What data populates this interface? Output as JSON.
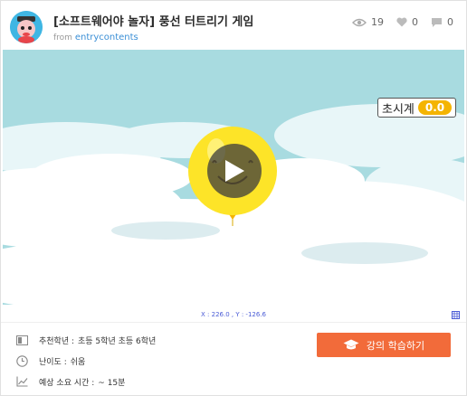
{
  "header": {
    "title": "[소프트웨어야 놀자] 풍선 터트리기 게임",
    "from_label": "from",
    "author": "entrycontents"
  },
  "stats": {
    "views": "19",
    "likes": "0",
    "comments": "0"
  },
  "stage": {
    "timer_label": "초시계",
    "timer_value": "0.0"
  },
  "coords": "X : 226.0 , Y : -126.6",
  "info": {
    "grade_label": "추천학년 :",
    "grade_value": "초등 5학년 초등 6학년",
    "difficulty_label": "난이도 :",
    "difficulty_value": "쉬움",
    "time_label": "예상 소요 시간 :",
    "time_value": "~ 15분"
  },
  "study_button": "강의 학습하기",
  "colors": {
    "accent": "#f26b3a",
    "link": "#3b8fd6",
    "sky": "#a8dbe0",
    "balloon": "#fde428"
  },
  "icons": [
    "eye-icon",
    "heart-icon",
    "comment-icon",
    "play-icon",
    "grid-icon",
    "book-icon",
    "clock-icon",
    "chart-icon",
    "graduation-cap-icon"
  ]
}
